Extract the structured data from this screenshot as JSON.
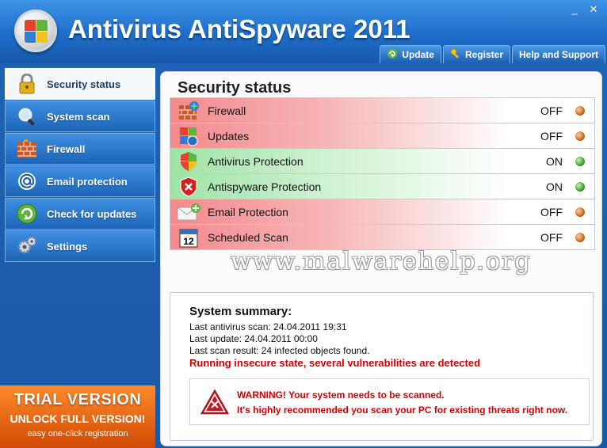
{
  "window": {
    "title": "Antivirus AntiSpyware 2011",
    "controls": {
      "minimize": "_",
      "close": "✕"
    }
  },
  "topnav": [
    {
      "label": "Update",
      "icon": "update-icon"
    },
    {
      "label": "Register",
      "icon": "key-icon"
    },
    {
      "label": "Help and Support",
      "icon": ""
    }
  ],
  "sidebar": {
    "items": [
      {
        "label": "Security status",
        "icon": "lock-icon",
        "active": true
      },
      {
        "label": "System scan",
        "icon": "magnifier-icon"
      },
      {
        "label": "Firewall",
        "icon": "brick-wall-icon"
      },
      {
        "label": "Email protection",
        "icon": "at-sign-icon"
      },
      {
        "label": "Check for updates",
        "icon": "update-icon"
      },
      {
        "label": "Settings",
        "icon": "gears-icon"
      }
    ]
  },
  "trial": {
    "line1": "TRIAL VERSION",
    "line2": "UNLOCK FULL VERSION!",
    "line3": "easy one-click registration"
  },
  "main": {
    "title": "Security status",
    "rows": [
      {
        "label": "Firewall",
        "state": "OFF",
        "status": "off",
        "icon": "firewall-icon"
      },
      {
        "label": "Updates",
        "state": "OFF",
        "status": "off",
        "icon": "windows-update-icon"
      },
      {
        "label": "Antivirus Protection",
        "state": "ON",
        "status": "on",
        "icon": "shield-icon"
      },
      {
        "label": "Antispyware Protection",
        "state": "ON",
        "status": "on",
        "icon": "shield-x-icon"
      },
      {
        "label": "Email Protection",
        "state": "OFF",
        "status": "off",
        "icon": "envelope-plus-icon"
      },
      {
        "label": "Scheduled Scan",
        "state": "OFF",
        "status": "off",
        "icon": "calendar-icon"
      }
    ],
    "watermark": "www.malwarehelp.org",
    "summary": {
      "heading": "System summary:",
      "last_antivirus_scan": "Last antivirus scan: 24.04.2011 19:31",
      "last_update": "Last update: 24.04.2011 00:00",
      "last_scan_result": "Last scan result: 24 infected objects found.",
      "warning_state": "Running insecure state, several vulnerabilities are detected"
    },
    "warning": {
      "line1": "WARNING! Your system needs to be scanned.",
      "line2": "It's highly recommended you scan your PC for existing threats right now."
    }
  },
  "colors": {
    "accent_blue": "#1e63b3",
    "warning_red": "#d40000",
    "off_row": "#f48a8c",
    "on_row": "#9fe3a5",
    "trial_orange": "#e8661a"
  }
}
